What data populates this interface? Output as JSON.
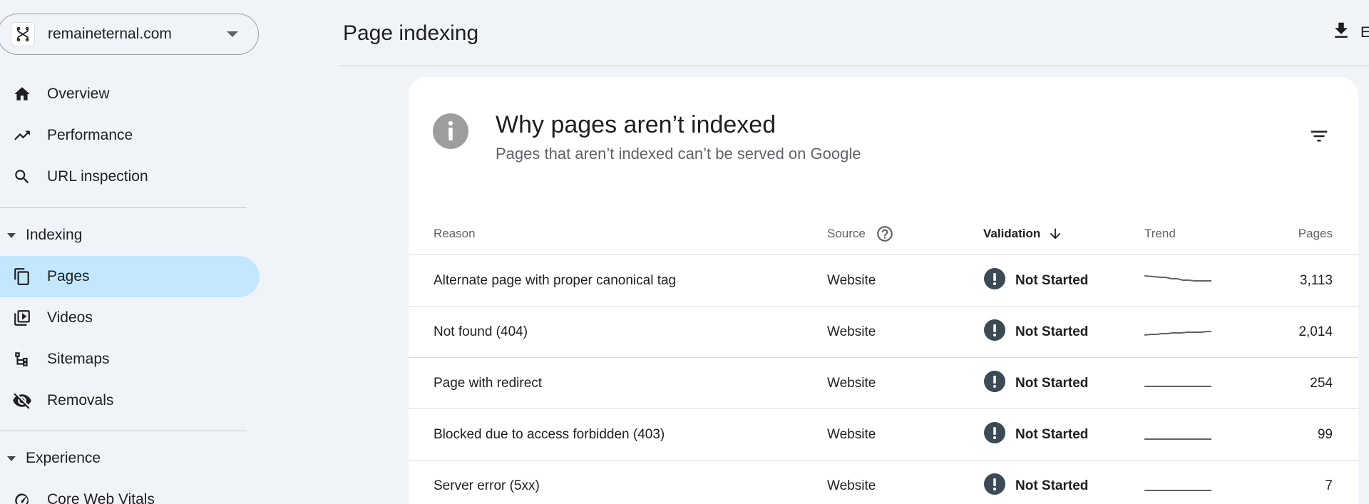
{
  "property": {
    "name": "remaineternal.com"
  },
  "nav": {
    "overview": "Overview",
    "performance": "Performance",
    "url_inspection": "URL inspection",
    "indexing_section": "Indexing",
    "pages": "Pages",
    "videos": "Videos",
    "sitemaps": "Sitemaps",
    "removals": "Removals",
    "experience_section": "Experience",
    "core_web_vitals": "Core Web Vitals"
  },
  "header": {
    "title": "Page indexing",
    "export_label": "E"
  },
  "card": {
    "title": "Why pages aren’t indexed",
    "subtitle": "Pages that aren’t indexed can’t be served on Google"
  },
  "table": {
    "columns": {
      "reason": "Reason",
      "source": "Source",
      "validation": "Validation",
      "trend": "Trend",
      "pages": "Pages"
    },
    "rows": [
      {
        "reason": "Alternate page with proper canonical tag",
        "source": "Website",
        "validation": "Not Started",
        "trend": "declining",
        "pages": "3,113"
      },
      {
        "reason": "Not found (404)",
        "source": "Website",
        "validation": "Not Started",
        "trend": "rising",
        "pages": "2,014"
      },
      {
        "reason": "Page with redirect",
        "source": "Website",
        "validation": "Not Started",
        "trend": "flat",
        "pages": "254"
      },
      {
        "reason": "Blocked due to access forbidden (403)",
        "source": "Website",
        "validation": "Not Started",
        "trend": "flat",
        "pages": "99"
      },
      {
        "reason": "Server error (5xx)",
        "source": "Website",
        "validation": "Not Started",
        "trend": "flat",
        "pages": "7"
      }
    ]
  },
  "colors": {
    "background": "#f0f4f9",
    "active_nav": "#c2e7ff",
    "alert_icon": "#3c4a55",
    "info_icon": "#9e9e9e",
    "sparkline": "#5f6368"
  },
  "icons": {
    "property": "site-logo-icon",
    "overview": "home-icon",
    "performance": "trending-up-icon",
    "url_inspection": "search-icon",
    "pages": "pages-icon",
    "videos": "video-page-icon",
    "sitemaps": "sitemap-icon",
    "removals": "visibility-off-icon",
    "core_web_vitals": "gauge-icon",
    "export": "download-icon",
    "info": "info-icon",
    "filter": "filter-icon",
    "help": "help-icon",
    "sort": "arrow-down-icon",
    "status": "alert-icon"
  }
}
